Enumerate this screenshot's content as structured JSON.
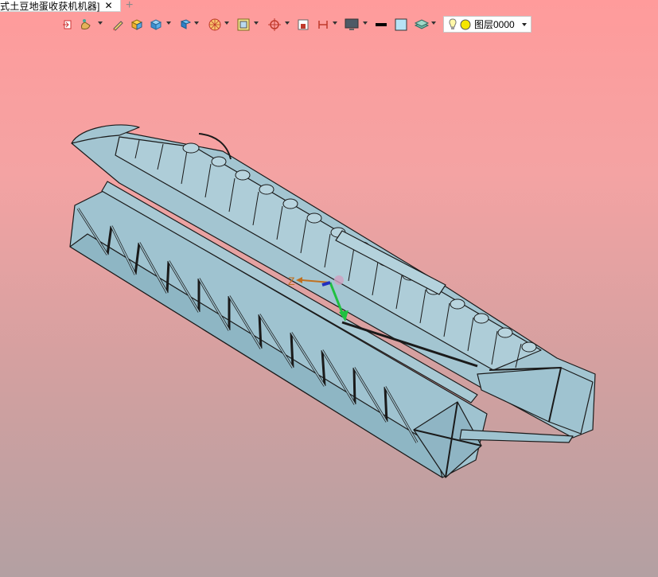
{
  "tab": {
    "title": "式土豆地蛋收获机机器]",
    "close_icon": "close-icon",
    "add_icon": "add-tab-icon"
  },
  "toolbar": {
    "icons": [
      "exit-icon",
      "paint-icon",
      "sketch-pen-icon",
      "box-solid-icon",
      "cube-icon",
      "view-cube-icon",
      "render-icon",
      "frame-icon",
      "coordinate-icon",
      "select-window-icon",
      "dimension-icon",
      "display-icon",
      "line-color-icon",
      "fill-color-icon",
      "layers-icon"
    ]
  },
  "layer": {
    "label": "图层0000",
    "light_icon": "bulb-icon",
    "color_icon": "layer-color-icon"
  },
  "triad": {
    "z_label": "Z"
  },
  "colors": {
    "model_fill": "#9fc3d0",
    "model_edge": "#1a1a1a",
    "bg_top": "#ff9b9b",
    "bg_bottom": "#b3a0a2"
  }
}
